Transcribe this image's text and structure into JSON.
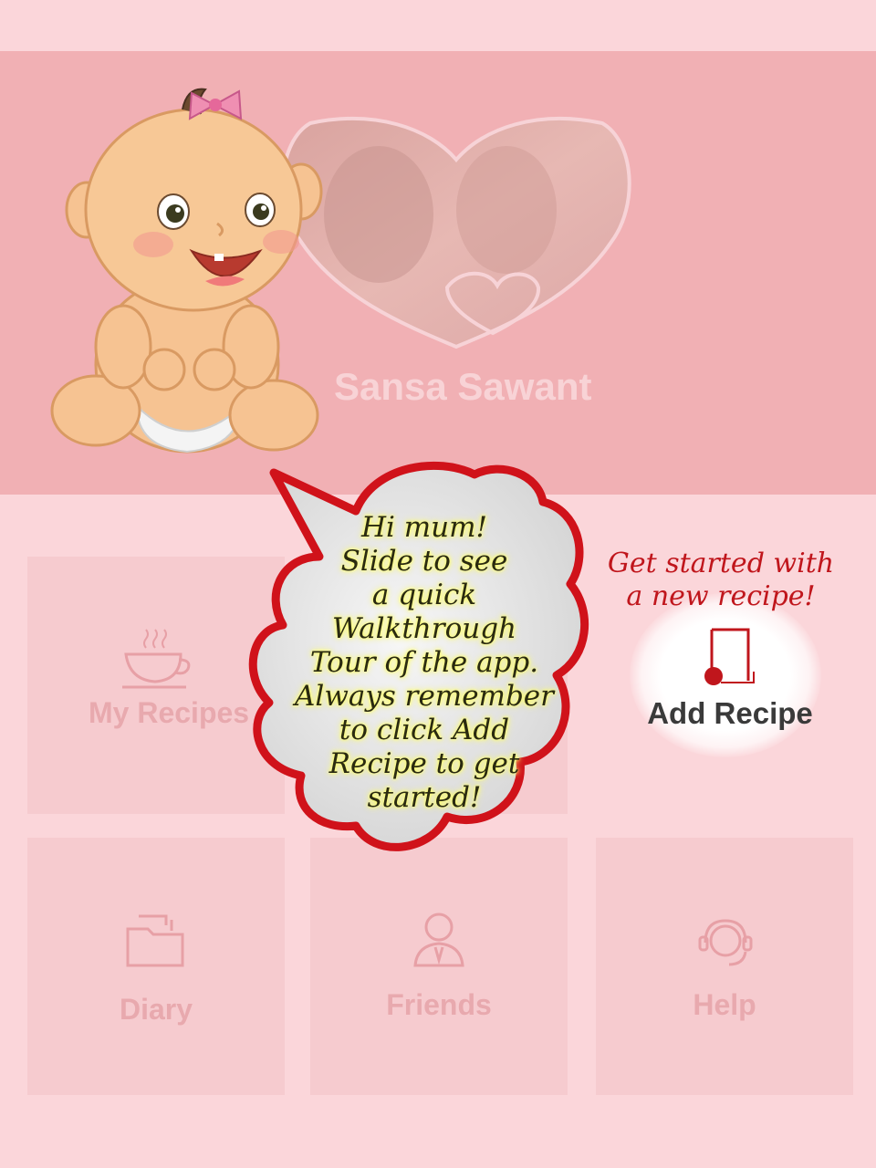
{
  "profile": {
    "name": "Sansa Sawant"
  },
  "tiles": {
    "my_recipes": {
      "label": "My Recipes",
      "icon": "teacup-icon"
    },
    "add_recipe": {
      "label": "Add Recipe",
      "icon": "add-recipe-icon"
    },
    "diary": {
      "label": "Diary",
      "icon": "folder-icon"
    },
    "friends": {
      "label": "Friends",
      "icon": "person-icon"
    },
    "help": {
      "label": "Help",
      "icon": "headset-icon"
    }
  },
  "walkthrough": {
    "hint": "Get started with a new recipe!",
    "hint_line1": "Get started with",
    "hint_line2": "a new recipe!",
    "bubble_lines": [
      "Hi mum!",
      "Slide to see",
      "a quick",
      "Walkthrough",
      "Tour of the app.",
      "Always remember",
      "to click Add",
      "Recipe to get",
      "started!"
    ]
  },
  "colors": {
    "page_bg": "#fbd6da",
    "header_bg": "#f1b0b4",
    "tile_bg": "#f6cbcf",
    "accent": "#c0161c"
  }
}
